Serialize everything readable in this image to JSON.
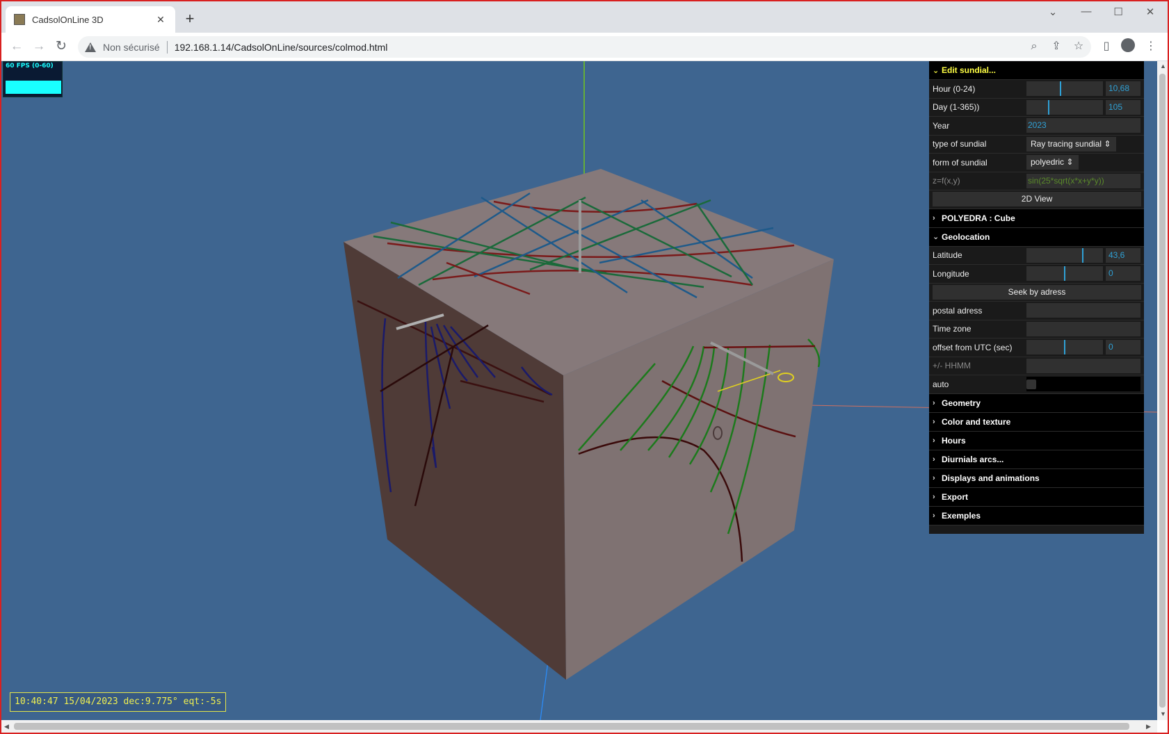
{
  "browser": {
    "tab_title": "CadsolOnLine 3D",
    "tab_close": "✕",
    "new_tab": "+",
    "not_secure": "Non sécurisé",
    "url": "192.168.1.14/CadsolOnLine/sources/colmod.html"
  },
  "viewport": {
    "fps_label": "60 FPS (0-60)",
    "status_text": "10:40:47 15/04/2023 dec:9.775° eqt:-5s",
    "background_color": "#3e6590"
  },
  "panel": {
    "edit_sundial": "Edit sundial...",
    "hour_label": "Hour  (0-24)",
    "hour_value": "10,68",
    "hour_fraction": 0.445,
    "day_label": "Day (1-365))",
    "day_value": "105",
    "day_fraction": 0.285,
    "year_label": "Year",
    "year_value": "2023",
    "type_label": "type of sundial",
    "type_value": "Ray tracing sundial",
    "form_label": "form of sundial",
    "form_value": "polyedric",
    "zf_label": "z=f(x,y)",
    "zf_value": "sin(25*sqrt(x*x+y*y))",
    "view_button": "2D View",
    "polyedra": "POLYEDRA : Cube",
    "geolocation": "Geolocation",
    "latitude_label": "Latitude",
    "latitude_value": "43,6",
    "latitude_fraction": 0.742,
    "longitude_label": "Longitude",
    "longitude_value": "0",
    "longitude_fraction": 0.5,
    "seek_button": "Seek by adress",
    "postal_label": "postal adress",
    "postal_value": "",
    "timezone_label": "Time zone",
    "timezone_value": "",
    "offset_label": "offset from UTC (sec)",
    "offset_value": "0",
    "offset_fraction": 0.5,
    "hhmm_label": "+/- HHMM",
    "hhmm_value": "",
    "auto_label": "auto",
    "folders": [
      "Geometry",
      "Color and texture",
      "Hours",
      "Diurnials arcs...",
      "Displays and animations",
      "Export",
      "Exemples"
    ]
  },
  "icons": {
    "back": "back-arrow-icon",
    "forward": "forward-arrow-icon",
    "reload": "reload-icon",
    "warning": "warning-icon",
    "zoom": "zoom-icon",
    "share": "share-icon",
    "star": "bookmark-star-icon",
    "sidepanel": "side-panel-icon",
    "profile": "profile-icon",
    "menu": "kebab-menu-icon"
  }
}
